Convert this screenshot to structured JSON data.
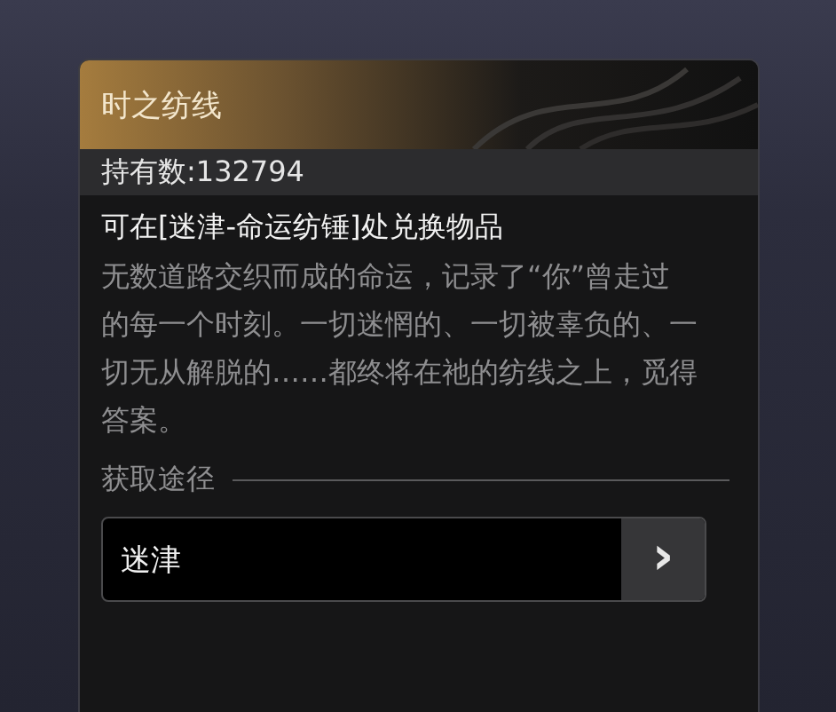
{
  "card": {
    "title": "时之纺线",
    "owned": "持有数:132794",
    "exchange_note": "可在[迷津-命运纺锤]处兑换物品",
    "description": "无数道路交织而成的命运，记录了“你”曾走过的每一个时刻。一切迷惘的、一切被辜负的、一切无从解脱的……都终将在祂的纺线之上，觅得答案。",
    "source_heading": "获取途径",
    "sources": [
      {
        "label": "迷津",
        "arrow": "›"
      }
    ]
  }
}
